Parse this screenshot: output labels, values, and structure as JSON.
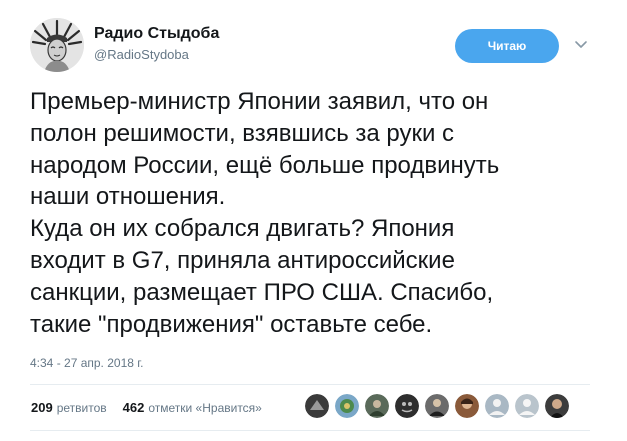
{
  "author": {
    "name": "Радио Стыдоба",
    "handle": "@RadioStydoba",
    "avatar_icon": "statue-of-liberty-avatar-icon"
  },
  "follow_button": {
    "label": "Читаю",
    "color": "#4aa6ee"
  },
  "menu_icon": "chevron-down-icon",
  "tweet": {
    "lines": [
      "Премьер-министр Японии заявил, что он",
      "полон решимости, взявшись за руки с",
      "народом России, ещё больше продвинуть",
      "наши отношения.",
      "Куда он их собрался двигать? Япония",
      "входит в G7, приняла антироссийские",
      "санкции, размещает ПРО США. Спасибо,",
      "такие \"продвижения\" оставьте себе."
    ]
  },
  "timestamp": "4:34 - 27 апр. 2018 г.",
  "stats": {
    "retweets_count": "209",
    "retweets_label": "ретвитов",
    "likes_count": "462",
    "likes_label": "отметки «Нравится»"
  },
  "likers": [
    {
      "name": "liker-1",
      "color": "#3a3a3a"
    },
    {
      "name": "liker-2",
      "color": "#7aa7c7"
    },
    {
      "name": "liker-3",
      "color": "#5a6a5a"
    },
    {
      "name": "liker-4",
      "color": "#2e2e2e"
    },
    {
      "name": "liker-5",
      "color": "#6b6b6b"
    },
    {
      "name": "liker-6",
      "color": "#8a5a3a"
    },
    {
      "name": "liker-7",
      "color": "#a9b8c4"
    },
    {
      "name": "liker-8",
      "color": "#b9c4cc"
    },
    {
      "name": "liker-9",
      "color": "#3c3c3c"
    }
  ]
}
